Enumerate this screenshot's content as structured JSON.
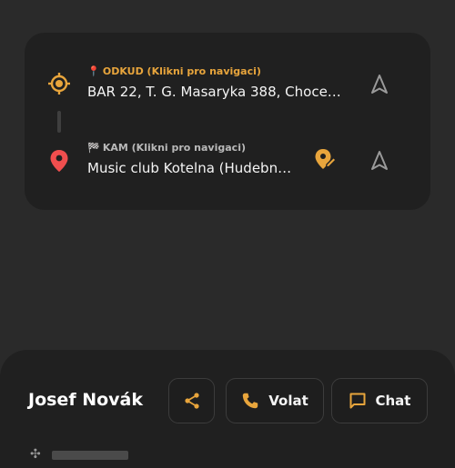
{
  "route": {
    "from": {
      "label_icon": "📍",
      "label": "ODKUD (Klikni pro navigaci)",
      "address": "BAR 22, T. G. Masaryka 388, Choce…"
    },
    "to": {
      "label_icon": "🏁",
      "label": "KAM (Klikni pro navigaci)",
      "address": "Music club Kotelna (Hudebn…"
    }
  },
  "driver": {
    "name": "Josef Novák"
  },
  "actions": {
    "call_label": "Volat",
    "chat_label": "Chat"
  },
  "colors": {
    "accent": "#e8a53c",
    "destination": "#f04e4e",
    "background": "#2a2a2a",
    "card": "#202020"
  },
  "icons": {
    "origin": "crosshair-target-icon",
    "destination": "map-pin-icon",
    "navigate": "navigation-arrow-icon",
    "edit_destination": "edit-location-icon",
    "share": "share-icon",
    "call": "phone-icon",
    "chat": "chat-bubble-icon"
  }
}
